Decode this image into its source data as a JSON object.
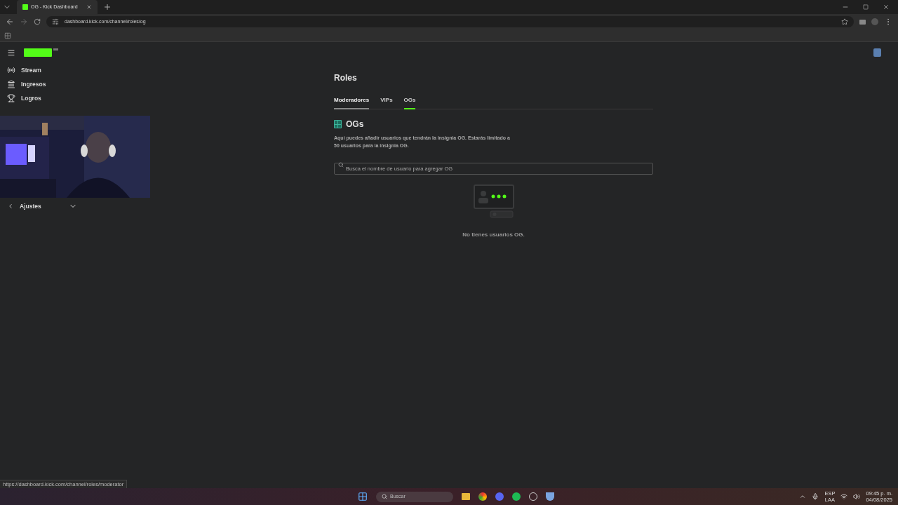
{
  "browser": {
    "tab_title": "OG - Kick Dashboard",
    "url": "dashboard.kick.com/channel/roles/og",
    "status_url": "https://dashboard.kick.com/channel/roles/moderator"
  },
  "sidebar": {
    "items": [
      {
        "label": "Stream",
        "kind": "stream"
      },
      {
        "label": "Ingresos",
        "kind": "income"
      },
      {
        "label": "Logros",
        "kind": "trophy"
      }
    ],
    "footer_item": {
      "label": "Ajustes",
      "expanded": false
    }
  },
  "page": {
    "title": "Roles",
    "tabs": [
      {
        "label": "Moderadores",
        "selected": false,
        "hovered": true
      },
      {
        "label": "VIPs",
        "selected": false,
        "hovered": false
      },
      {
        "label": "OGs",
        "selected": true,
        "hovered": false
      }
    ],
    "section_title": "OGs",
    "description": "Aquí puedes añadir usuarios que tendrán la insignia OG. Estarás limitado a 50 usuarios para la insignia OG.",
    "search": {
      "placeholder": "Busca el nombre de usuario para agregar OG"
    },
    "empty_text": "No tienes usuarios OG."
  },
  "taskbar": {
    "search_placeholder": "Buscar",
    "language": "ESP",
    "layout": "LAA",
    "time": "09:45 p. m.",
    "date": "04/08/2025"
  }
}
